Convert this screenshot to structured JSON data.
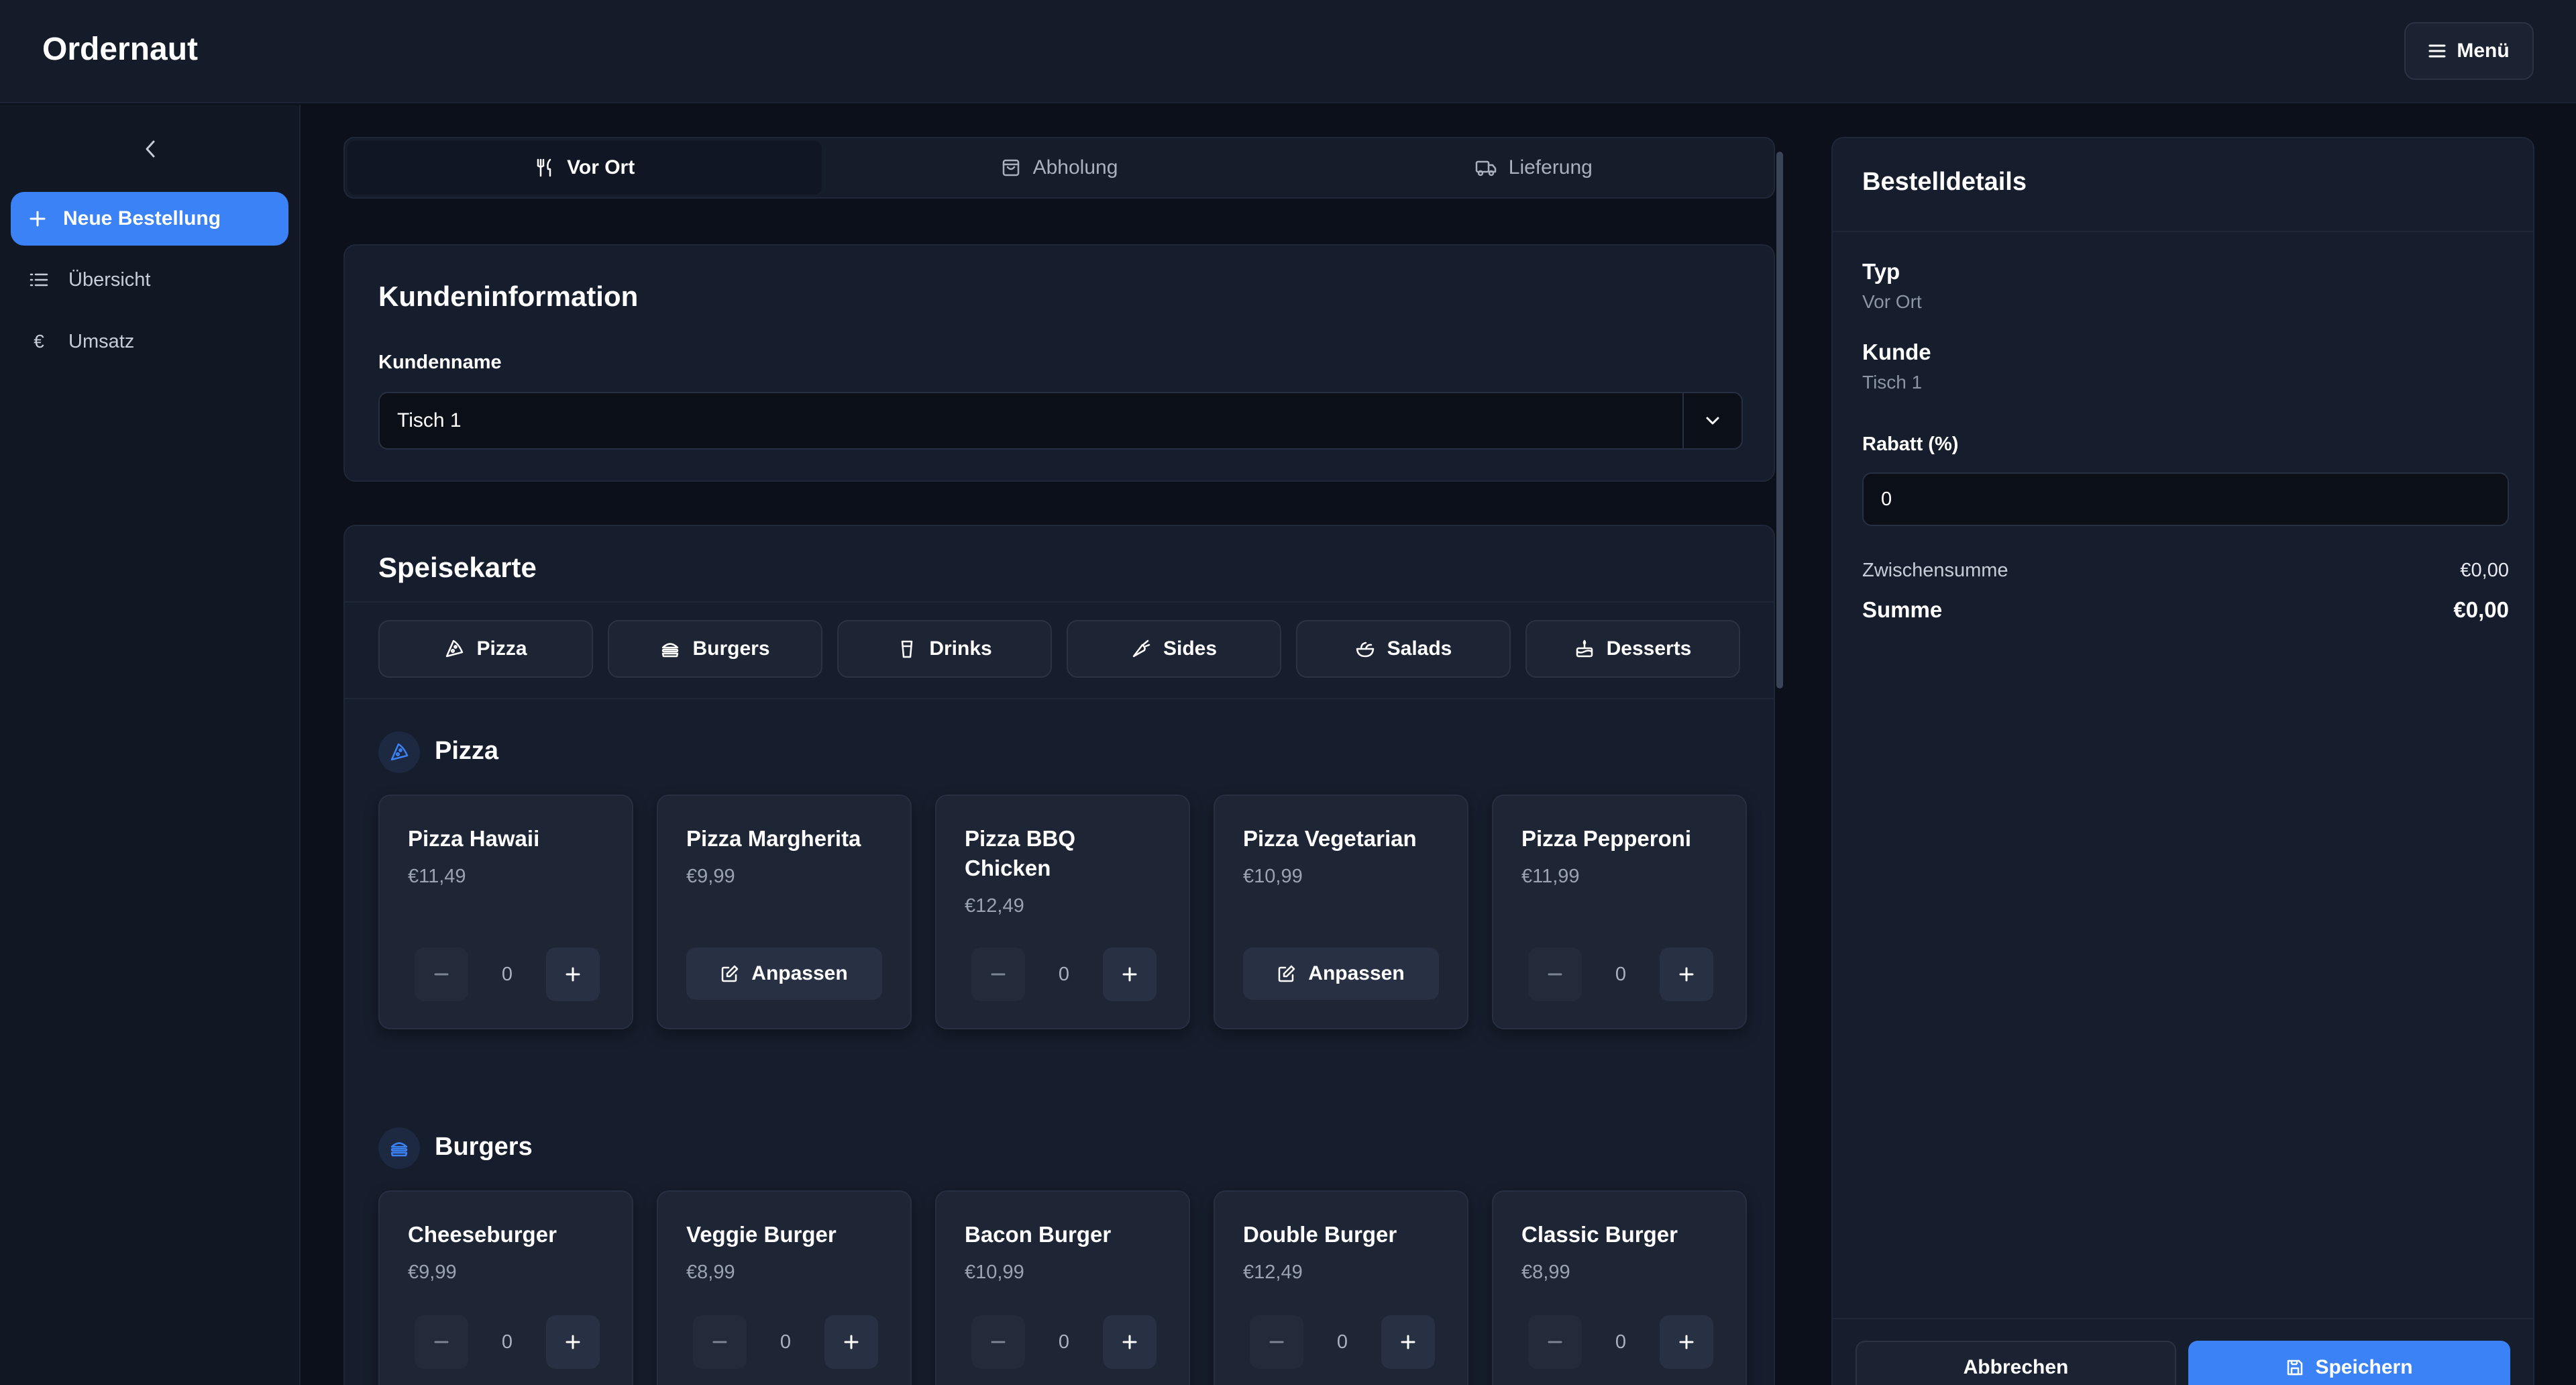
{
  "app": {
    "title": "Ordernaut",
    "menu_label": "Menü"
  },
  "sidebar": {
    "new_order_label": "Neue Bestellung",
    "items": [
      {
        "label": "Übersicht",
        "icon": "list-icon"
      },
      {
        "label": "Umsatz",
        "icon": "€"
      }
    ]
  },
  "order_types": [
    "Vor Ort",
    "Abholung",
    "Lieferung"
  ],
  "customer_section": {
    "title": "Kundeninformation",
    "name_label": "Kundenname",
    "name_value": "Tisch 1"
  },
  "menu_section": {
    "title": "Speisekarte",
    "categories": [
      "Pizza",
      "Burgers",
      "Drinks",
      "Sides",
      "Salads",
      "Desserts"
    ],
    "customize_label": "Anpassen",
    "groups": [
      {
        "title": "Pizza",
        "items": [
          {
            "name": "Pizza Hawaii",
            "price": "€11,49",
            "qty": "0"
          },
          {
            "name": "Pizza Margherita",
            "price": "€9,99"
          },
          {
            "name": "Pizza BBQ Chicken",
            "price": "€12,49",
            "qty": "0"
          },
          {
            "name": "Pizza Vegetarian",
            "price": "€10,99"
          },
          {
            "name": "Pizza Pepperoni",
            "price": "€11,99",
            "qty": "0"
          }
        ]
      },
      {
        "title": "Burgers",
        "items": [
          {
            "name": "Cheeseburger",
            "price": "€9,99",
            "qty": "0"
          },
          {
            "name": "Veggie Burger",
            "price": "€8,99",
            "qty": "0"
          },
          {
            "name": "Bacon Burger",
            "price": "€10,99",
            "qty": "0"
          },
          {
            "name": "Double Burger",
            "price": "€12,49",
            "qty": "0"
          },
          {
            "name": "Classic Burger",
            "price": "€8,99",
            "qty": "0"
          }
        ]
      }
    ]
  },
  "order_details": {
    "title": "Bestelldetails",
    "type_label": "Typ",
    "type_value": "Vor Ort",
    "customer_label": "Kunde",
    "customer_value": "Tisch 1",
    "discount_label": "Rabatt (%)",
    "discount_value": "0",
    "subtotal_label": "Zwischensumme",
    "subtotal_value": "€0,00",
    "total_label": "Summe",
    "total_value": "€0,00",
    "cancel_label": "Abbrechen",
    "save_label": "Speichern"
  },
  "colors": {
    "accent": "#3b82f6",
    "background": "#0c101a",
    "card": "#161d2c"
  }
}
